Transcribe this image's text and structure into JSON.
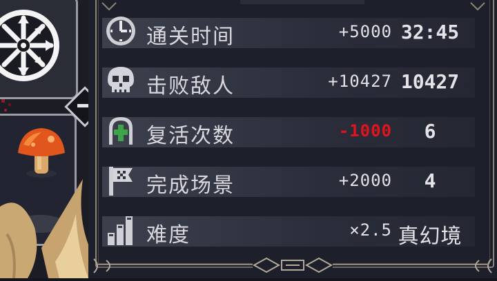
{
  "rows": [
    {
      "icon": "clock-icon",
      "label": "通关时间",
      "bonus": "+5000",
      "value": "32:45"
    },
    {
      "icon": "skull-icon",
      "label": "击败敌人",
      "bonus": "+10427",
      "value": "10427"
    },
    {
      "icon": "tombstone-cross-icon",
      "label": "复活次数",
      "bonus": "-1000",
      "value": "6",
      "bonus_color": "#e0141c"
    },
    {
      "icon": "flag-icon",
      "label": "完成场景",
      "bonus": "+2000",
      "value": "4"
    },
    {
      "icon": "bar-chart-icon",
      "label": "难度",
      "bonus": "×2.5",
      "value": "真幻境"
    }
  ],
  "sidebar": {
    "top_icon": "snowflake-icon",
    "collapse_icon": "minus-icon",
    "item_icon": "mushroom-icon"
  },
  "colors": {
    "panel": "#1d202b",
    "text": "#d8d8de",
    "negative": "#e0141c",
    "frame": "#8d8478"
  }
}
